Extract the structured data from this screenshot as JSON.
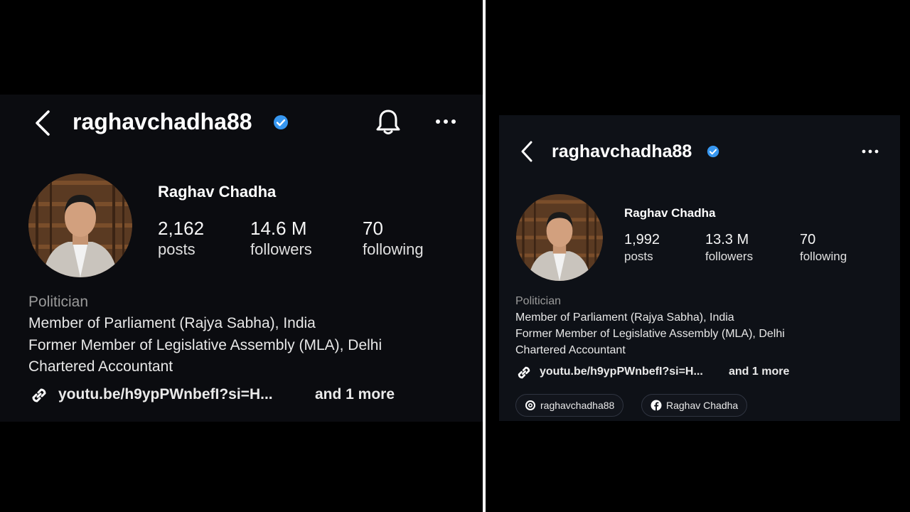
{
  "left": {
    "username": "raghavchadha88",
    "display_name": "Raghav Chadha",
    "stats": [
      {
        "value": "2,162",
        "label": "posts"
      },
      {
        "value": "14.6 M",
        "label": "followers"
      },
      {
        "value": "70",
        "label": "following"
      }
    ],
    "category": "Politician",
    "bio": [
      "Member of Parliament (Rajya Sabha), India",
      "Former Member of Legislative Assembly (MLA), Delhi",
      "Chartered Accountant"
    ],
    "link_text": "youtu.be/h9ypPWnbefI?si=H...",
    "link_more": "and 1 more"
  },
  "right": {
    "username": "raghavchadha88",
    "display_name": "Raghav Chadha",
    "stats": [
      {
        "value": "1,992",
        "label": "posts"
      },
      {
        "value": "13.3 M",
        "label": "followers"
      },
      {
        "value": "70",
        "label": "following"
      }
    ],
    "category": "Politician",
    "bio": [
      "Member of Parliament (Rajya Sabha), India",
      "Former Member of Legislative Assembly (MLA), Delhi",
      "Chartered Accountant"
    ],
    "link_text": "youtu.be/h9ypPWnbefI?si=H...",
    "link_more": "and 1 more",
    "pills": [
      {
        "icon": "threads-icon",
        "label": "raghavchadha88"
      },
      {
        "icon": "facebook-icon",
        "label": "Raghav Chadha"
      }
    ]
  },
  "colors": {
    "verified": "#3797f0",
    "background": "#0b0c10"
  }
}
